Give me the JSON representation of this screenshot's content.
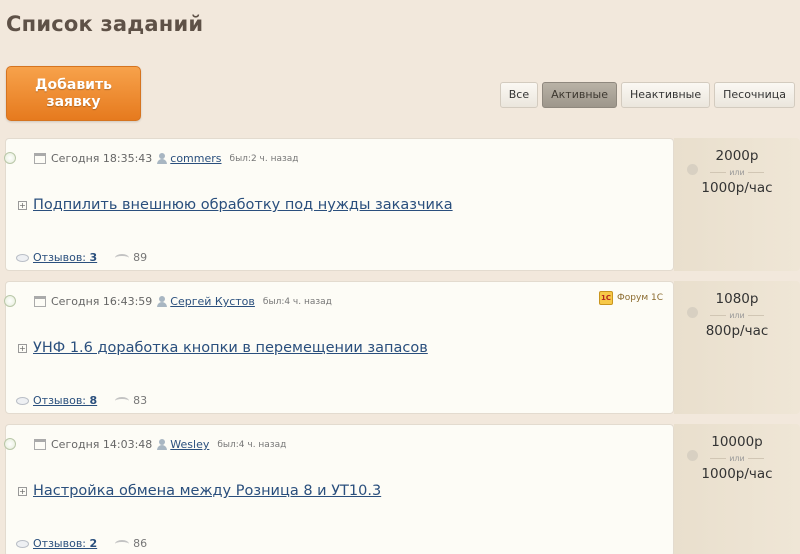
{
  "page": {
    "title": "Список заданий"
  },
  "add_button": {
    "label": "Добавить\nзаявку"
  },
  "filters": [
    {
      "label": "Все",
      "active": false
    },
    {
      "label": "Активные",
      "active": true
    },
    {
      "label": "Неактивные",
      "active": false
    },
    {
      "label": "Песочница",
      "active": false
    }
  ],
  "tasks": [
    {
      "date": "Сегодня 18:35:43",
      "user": "commers",
      "seen": "был:2 ч. назад",
      "title": "Подпилить внешнюю обработку под нужды заказчика",
      "reviews_label": "Отзывов:",
      "reviews_count": "3",
      "views": "89",
      "price": "2000р",
      "or": "или",
      "hourly": "1000р/час",
      "forum": ""
    },
    {
      "date": "Сегодня 16:43:59",
      "user": "Сергей Кустов",
      "seen": "был:4 ч. назад",
      "title": "УНФ 1.6 доработка кнопки в перемещении запасов",
      "reviews_label": "Отзывов:",
      "reviews_count": "8",
      "views": "83",
      "price": "1080р",
      "or": "или",
      "hourly": "800р/час",
      "forum": "Форум 1С"
    },
    {
      "date": "Сегодня 14:03:48",
      "user": "Wesley",
      "seen": "был:4 ч. назад",
      "title": "Настройка обмена между Розница 8 и УТ10.3",
      "reviews_label": "Отзывов:",
      "reviews_count": "2",
      "views": "86",
      "price": "10000р",
      "or": "или",
      "hourly": "1000р/час",
      "forum": ""
    }
  ],
  "icons": {
    "calendar": "calendar-icon",
    "user": "user-icon",
    "comment": "comment-bubble-icon",
    "views": "eye-icon",
    "expand": "expand-plus-icon",
    "forum": "forum-1c-icon"
  },
  "colors": {
    "accent": "#e67a1e",
    "link": "#2a4f7d",
    "background": "#f2e8dc"
  }
}
